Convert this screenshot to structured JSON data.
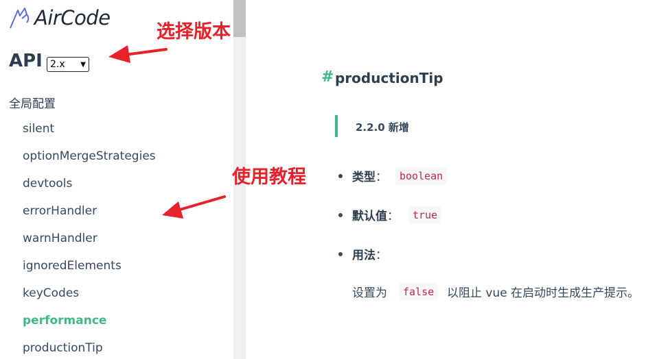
{
  "logo": {
    "text": "AirCode",
    "icon": "cat-outline-icon"
  },
  "sidebar": {
    "title": "API",
    "version": "2.x",
    "group": "全局配置",
    "items": [
      {
        "label": "silent"
      },
      {
        "label": "optionMergeStrategies"
      },
      {
        "label": "devtools"
      },
      {
        "label": "errorHandler"
      },
      {
        "label": "warnHandler"
      },
      {
        "label": "ignoredElements"
      },
      {
        "label": "keyCodes"
      },
      {
        "label": "performance",
        "active": true
      },
      {
        "label": "productionTip"
      }
    ]
  },
  "content": {
    "hash": "#",
    "heading": "productionTip",
    "note": "2.2.0 新增",
    "type_label": "类型",
    "type_value": "boolean",
    "default_label": "默认值",
    "default_value": "true",
    "usage_label": "用法",
    "colon": "：",
    "usage_prefix": "设置为",
    "usage_code": "false",
    "usage_suffix": "以阻止 vue 在启动时生成生产提示。"
  },
  "annotations": {
    "version_hint": "选择版本",
    "usage_hint": "使用教程"
  },
  "colors": {
    "accent": "#42b983",
    "annotation": "#e8202a",
    "code": "#c7254e"
  }
}
